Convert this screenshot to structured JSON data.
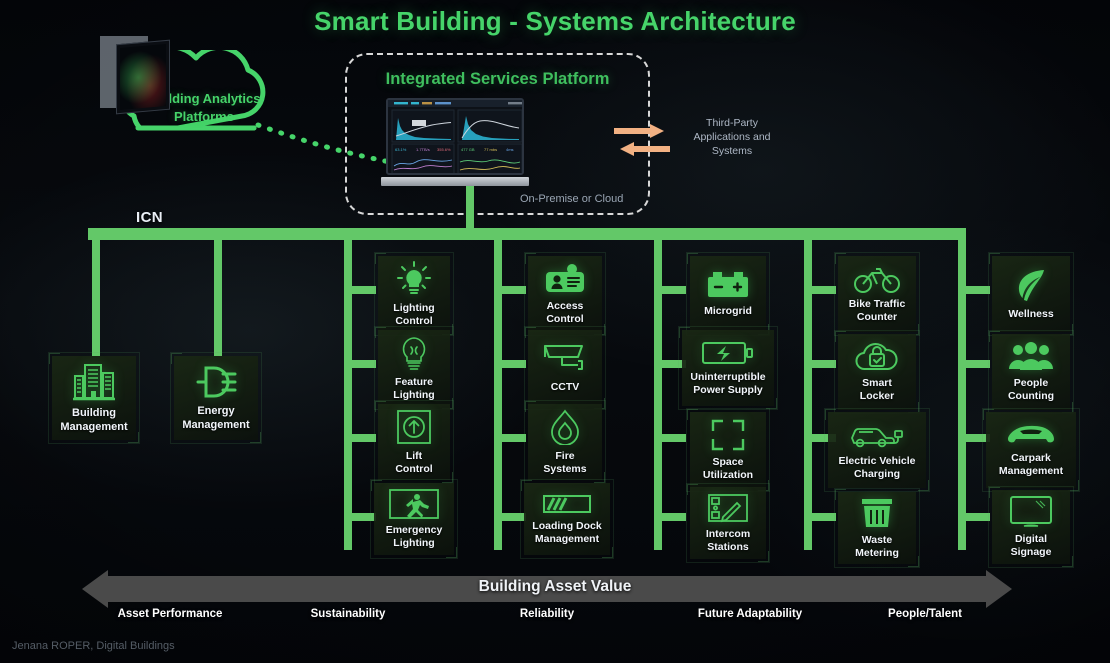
{
  "title": "Smart Building - Systems Architecture",
  "cloud": {
    "label": "Building Analytics\nPlatforms",
    "line1": "Building Analytics",
    "line2": "Platforms"
  },
  "platform": {
    "title": "Integrated Services Platform",
    "subtitle": "On-Premise or Cloud",
    "monitor_icon": "dashboard-monitor-icon"
  },
  "third_party": {
    "line1": "Third-Party",
    "line2": "Applications and",
    "line3": "Systems"
  },
  "network": {
    "bus_label": "ICN",
    "bus_color": "#63c868"
  },
  "colors": {
    "accent_green": "#46d46a",
    "icon_green": "#4cc95f",
    "bus_green": "#63c868",
    "arrow_orange": "#f2b183",
    "value_bar_grey": "#4a4a4a",
    "background": "#05070a"
  },
  "columns": [
    {
      "name": "asset-performance",
      "tiles": [
        {
          "label": "Building\nManagement",
          "line1": "Building",
          "line2": "Management",
          "icon": "building-icon"
        },
        {
          "label": "Energy\nManagement",
          "line1": "Energy",
          "line2": "Management",
          "icon": "power-plug-icon"
        }
      ]
    },
    {
      "name": "sustainability",
      "tiles": [
        {
          "label": "Lighting\nControl",
          "line1": "Lighting",
          "line2": "Control",
          "icon": "light-bulb-rays-icon"
        },
        {
          "label": "Feature\nLighting",
          "line1": "Feature",
          "line2": "Lighting",
          "icon": "feature-bulb-icon"
        },
        {
          "label": "Lift\nControl",
          "line1": "Lift",
          "line2": "Control",
          "icon": "lift-arrow-icon"
        },
        {
          "label": "Emergency\nLighting",
          "line1": "Emergency",
          "line2": "Lighting",
          "icon": "exit-running-man-icon"
        }
      ]
    },
    {
      "name": "reliability",
      "tiles": [
        {
          "label": "Access\nControl",
          "line1": "Access",
          "line2": "Control",
          "icon": "id-badge-icon"
        },
        {
          "label": "CCTV",
          "line1": "CCTV",
          "line2": "",
          "icon": "cctv-camera-icon"
        },
        {
          "label": "Fire\nSystems",
          "line1": "Fire",
          "line2": "Systems",
          "icon": "flame-icon"
        },
        {
          "label": "Loading Dock\nManagement",
          "line1": "Loading Dock",
          "line2": "Management",
          "icon": "loading-dock-icon"
        }
      ]
    },
    {
      "name": "future-adaptability",
      "tiles": [
        {
          "label": "Microgrid",
          "line1": "Microgrid",
          "line2": "",
          "icon": "battery-terminal-icon"
        },
        {
          "label": "Uninterruptible\nPower Supply",
          "line1": "Uninterruptible",
          "line2": "Power Supply",
          "icon": "ups-battery-icon"
        },
        {
          "label": "Space\nUtilization",
          "line1": "Space",
          "line2": "Utilization",
          "icon": "space-bracket-icon"
        },
        {
          "label": "Intercom\nStations",
          "line1": "Intercom",
          "line2": "Stations",
          "icon": "intercom-panel-icon"
        }
      ]
    },
    {
      "name": "people-talent-left",
      "tiles": [
        {
          "label": "Bike Traffic\nCounter",
          "line1": "Bike Traffic",
          "line2": "Counter",
          "icon": "bicycle-icon"
        },
        {
          "label": "Smart\nLocker",
          "line1": "Smart",
          "line2": "Locker",
          "icon": "cloud-lock-icon"
        },
        {
          "label": "Electric Vehicle\nCharging",
          "line1": "Electric Vehicle",
          "line2": "Charging",
          "icon": "ev-charging-car-icon"
        },
        {
          "label": "Waste\nMetering",
          "line1": "Waste",
          "line2": "Metering",
          "icon": "trash-bin-icon"
        }
      ]
    },
    {
      "name": "people-talent-right",
      "tiles": [
        {
          "label": "Wellness",
          "line1": "Wellness",
          "line2": "",
          "icon": "leaf-icon"
        },
        {
          "label": "People\nCounting",
          "line1": "People",
          "line2": "Counting",
          "icon": "people-group-icon"
        },
        {
          "label": "Carpark\nManagement",
          "line1": "Carpark",
          "line2": "Management",
          "icon": "car-icon"
        },
        {
          "label": "Digital\nSignage",
          "line1": "Digital",
          "line2": "Signage",
          "icon": "display-screen-icon"
        }
      ]
    }
  ],
  "value_bar": {
    "label": "Building Asset Value",
    "categories": [
      "Asset Performance",
      "Sustainability",
      "Reliability",
      "Future Adaptability",
      "People/Talent"
    ]
  },
  "credit": "Jenana ROPER, Digital Buildings"
}
